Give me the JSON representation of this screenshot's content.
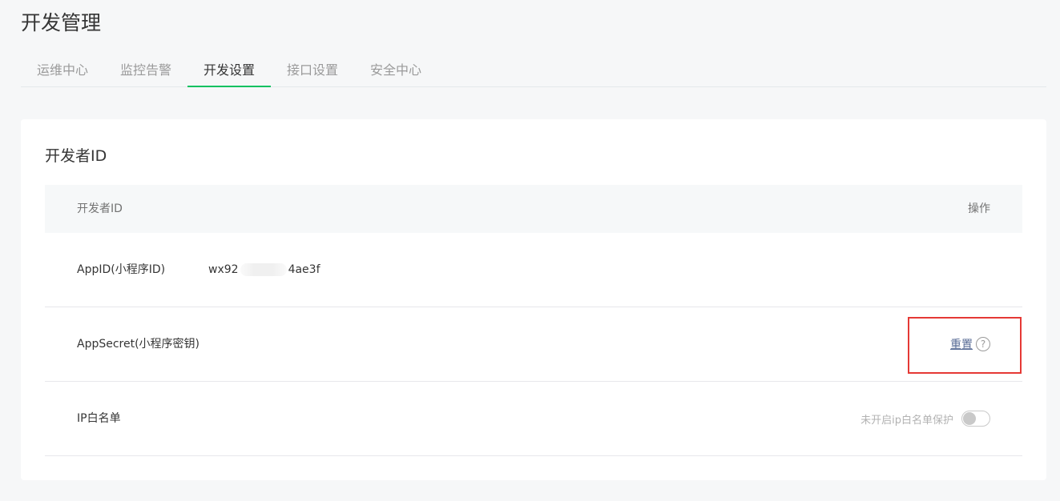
{
  "header": {
    "title": "开发管理"
  },
  "tabs": [
    {
      "label": "运维中心"
    },
    {
      "label": "监控告警"
    },
    {
      "label": "开发设置"
    },
    {
      "label": "接口设置"
    },
    {
      "label": "安全中心"
    }
  ],
  "active_tab": "开发设置",
  "section": {
    "title": "开发者ID",
    "table": {
      "header_left": "开发者ID",
      "header_right": "操作"
    },
    "appid": {
      "label": "AppID(小程序ID)",
      "value_prefix": "wx92",
      "value_suffix": "4ae3f"
    },
    "appsecret": {
      "label": "AppSecret(小程序密钥)",
      "action": "重置",
      "help_icon": "?"
    },
    "ip_whitelist": {
      "label": "IP白名单",
      "status": "未开启ip白名单保护",
      "enabled": false
    }
  },
  "colors": {
    "accent_green": "#07c160",
    "link_blue": "#576b95",
    "highlight_red": "#e53935"
  }
}
